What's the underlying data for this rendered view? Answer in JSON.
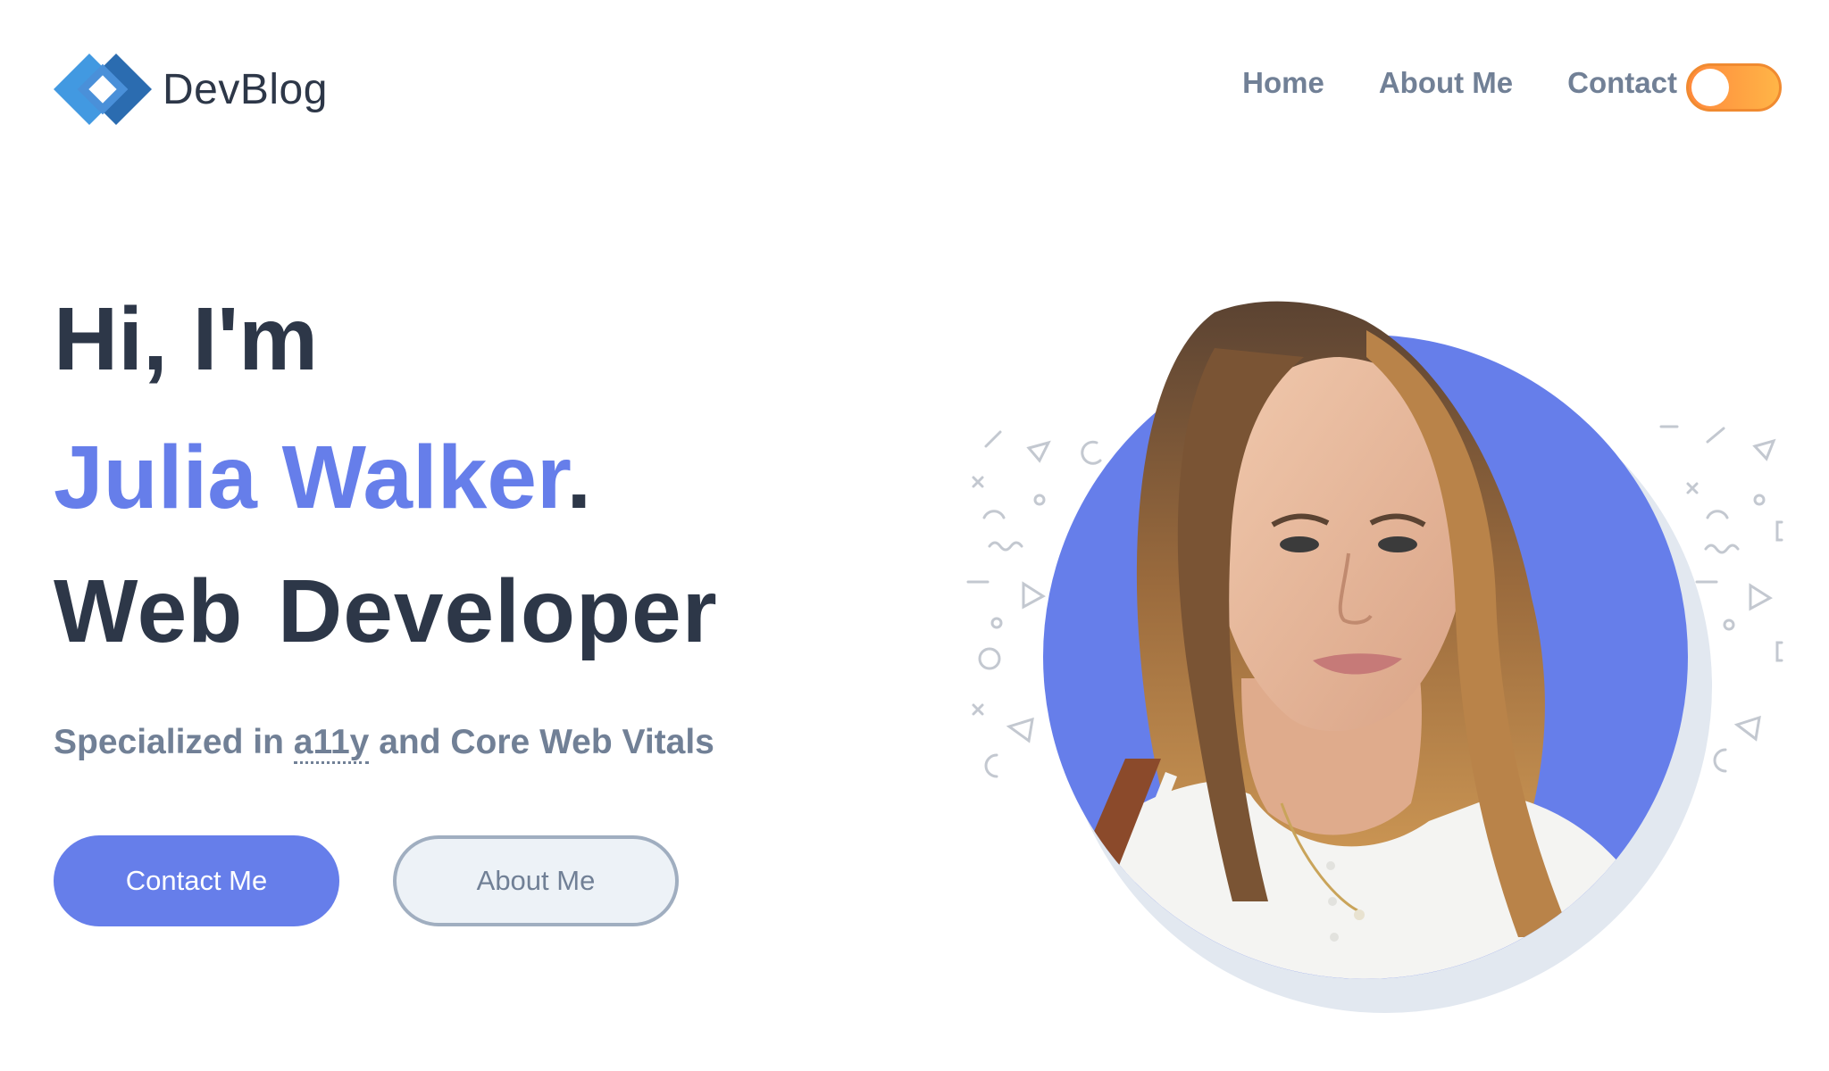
{
  "header": {
    "brand": "DevBlog",
    "brand_icon": "diamond-chain-logo-icon",
    "nav": [
      "Home",
      "About Me",
      "Contact"
    ],
    "theme_toggle": {
      "state": "off",
      "colors": [
        "#ff8a3d",
        "#ffb547"
      ]
    }
  },
  "hero": {
    "greeting": "Hi, I'm",
    "name": "Julia Walker",
    "name_period": ".",
    "role": "Web Developer",
    "tagline_prefix": "Specialized in ",
    "tagline_abbr": "a11y",
    "tagline_suffix": " and Core Web Vitals",
    "primary_button": "Contact Me",
    "secondary_button": "About Me",
    "portrait_icon": "portrait-photo",
    "colors": {
      "accent": "#667eea",
      "heading": "#2d3748",
      "muted": "#718096",
      "shadow_circle": "#e2e8f0"
    }
  }
}
